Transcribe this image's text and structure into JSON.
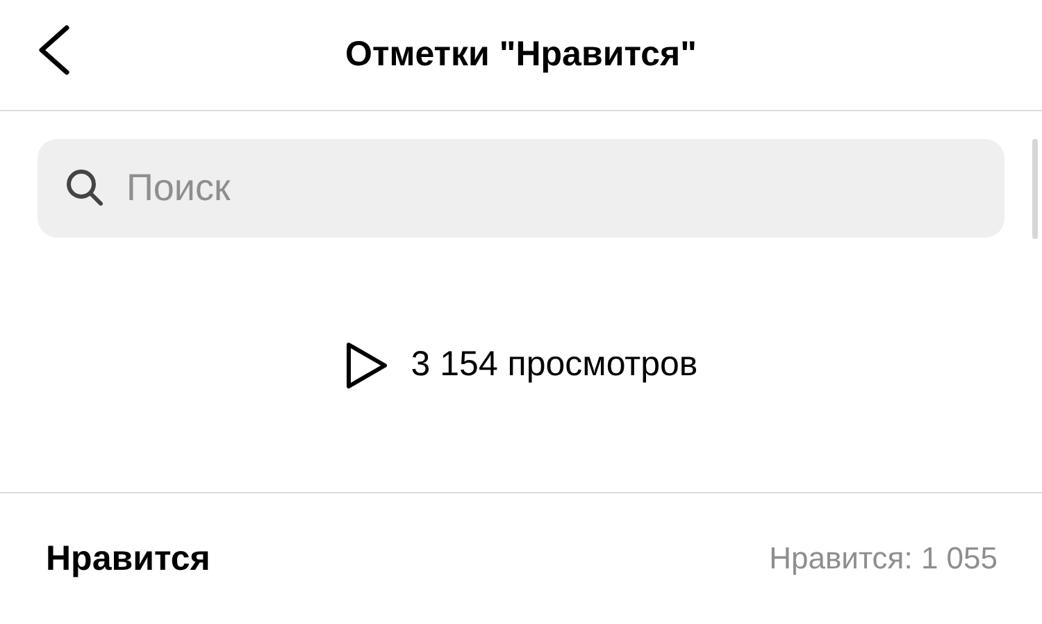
{
  "header": {
    "title": "Отметки \"Нравится\""
  },
  "search": {
    "placeholder": "Поиск"
  },
  "views": {
    "text": "3 154 просмотров"
  },
  "likes_row": {
    "label": "Нравится",
    "count": "Нравится: 1 055"
  }
}
